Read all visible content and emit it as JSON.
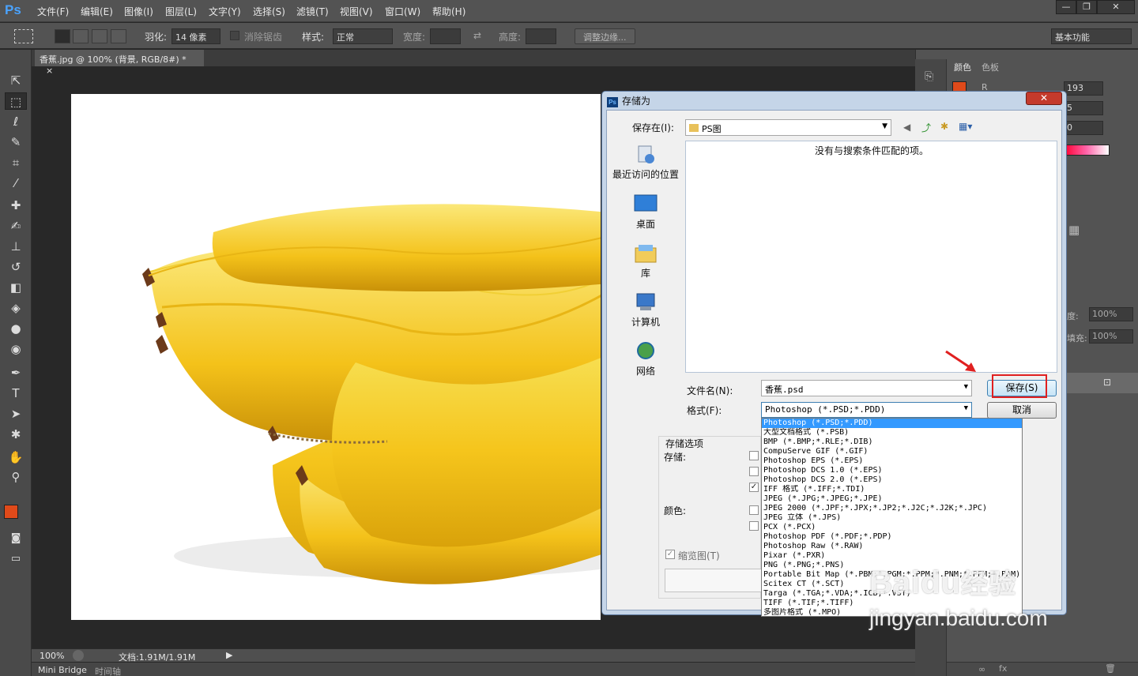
{
  "menubar": {
    "logo": "Ps",
    "items": [
      "文件(F)",
      "编辑(E)",
      "图像(I)",
      "图层(L)",
      "文字(Y)",
      "选择(S)",
      "滤镜(T)",
      "视图(V)",
      "窗口(W)",
      "帮助(H)"
    ],
    "window_controls": [
      "—",
      "❐",
      "✕"
    ]
  },
  "options": {
    "feather_label": "羽化:",
    "feather_value": "14 像素",
    "antialias_label": "消除锯齿",
    "style_label": "样式:",
    "style_value": "正常",
    "width_label": "宽度:",
    "height_label": "高度:",
    "refine_label": "调整边缘...",
    "workspace": "基本功能"
  },
  "document": {
    "tab_title": "香蕉.jpg @ 100% (背景, RGB/8#) *",
    "tab_close": "×"
  },
  "statusbar": {
    "zoom": "100%",
    "doc_info": "文档:1.91M/1.91M",
    "tabs": [
      "Mini Bridge",
      "时间轴"
    ]
  },
  "panels": {
    "color_tab": "颜色",
    "swatches_tab": "色板",
    "r_label": "R",
    "values": [
      "193",
      "5",
      "0"
    ],
    "opacity_label": "度:",
    "opacity_value": "100%",
    "fill_label": "填充:",
    "fill_value": "100%"
  },
  "dialog": {
    "title": "存储为",
    "logo": "Ps",
    "close": "✕",
    "save_in_label": "保存在(I):",
    "save_in_value": "PS图",
    "empty_message": "没有与搜索条件匹配的项。",
    "places": [
      "最近访问的位置",
      "桌面",
      "库",
      "计算机",
      "网络"
    ],
    "filename_label": "文件名(N):",
    "filename_value": "香蕉.psd",
    "format_label": "格式(F):",
    "format_value": "Photoshop (*.PSD;*.PDD)",
    "save_button": "保存(S)",
    "cancel_button": "取消",
    "options_title": "存储选项",
    "store_label": "存储:",
    "color_label": "颜色:",
    "thumbnail_label": "缩览图(T)",
    "formats": [
      "Photoshop (*.PSD;*.PDD)",
      "大型文档格式 (*.PSB)",
      "BMP (*.BMP;*.RLE;*.DIB)",
      "CompuServe GIF (*.GIF)",
      "Photoshop EPS (*.EPS)",
      "Photoshop DCS 1.0 (*.EPS)",
      "Photoshop DCS 2.0 (*.EPS)",
      "IFF 格式 (*.IFF;*.TDI)",
      "JPEG (*.JPG;*.JPEG;*.JPE)",
      "JPEG 2000 (*.JPF;*.JPX;*.JP2;*.J2C;*.J2K;*.JPC)",
      "JPEG 立体 (*.JPS)",
      "PCX (*.PCX)",
      "Photoshop PDF (*.PDF;*.PDP)",
      "Photoshop Raw (*.RAW)",
      "Pixar (*.PXR)",
      "PNG (*.PNG;*.PNS)",
      "Portable Bit Map (*.PBM;*.PGM;*.PPM;*.PNM;*.PFM;*.PAM)",
      "Scitex CT (*.SCT)",
      "Targa (*.TGA;*.VDA;*.ICB;*.VST)",
      "TIFF (*.TIF;*.TIFF)",
      "多图片格式 (*.MPO)"
    ]
  },
  "watermark": {
    "brand": "Baidu",
    "suffix": "经验",
    "url": "jingyan.baidu.com"
  },
  "colors": {
    "foreground": "#e04a1a",
    "background": "#c21c1c",
    "highlight": "#e02020",
    "selection": "#3399ff"
  }
}
